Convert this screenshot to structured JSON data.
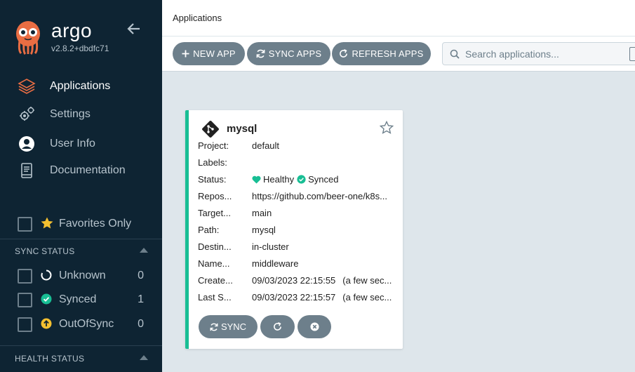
{
  "brand": {
    "name": "argo",
    "version": "v2.8.2+dbdfc71"
  },
  "nav": [
    {
      "label": "Applications",
      "icon": "stack-icon"
    },
    {
      "label": "Settings",
      "icon": "gear-icon"
    },
    {
      "label": "User Info",
      "icon": "user-icon"
    },
    {
      "label": "Documentation",
      "icon": "book-icon"
    }
  ],
  "filters": {
    "favorites_label": "Favorites Only",
    "sync_status": {
      "heading": "SYNC STATUS",
      "items": [
        {
          "label": "Unknown",
          "count": "0"
        },
        {
          "label": "Synced",
          "count": "1"
        },
        {
          "label": "OutOfSync",
          "count": "0"
        }
      ]
    },
    "health_status": {
      "heading": "HEALTH STATUS"
    }
  },
  "header": {
    "title": "Applications"
  },
  "toolbar": {
    "new_app": "NEW APP",
    "sync_apps": "SYNC APPS",
    "refresh_apps": "REFRESH APPS",
    "search_placeholder": "Search applications..."
  },
  "app": {
    "name": "mysql",
    "fields": [
      {
        "key": "Project:",
        "value": "default"
      },
      {
        "key": "Labels:",
        "value": ""
      },
      {
        "key": "Status:",
        "value": ""
      },
      {
        "key": "Repos...",
        "value": "https://github.com/beer-one/k8s..."
      },
      {
        "key": "Target...",
        "value": "main"
      },
      {
        "key": "Path:",
        "value": "mysql"
      },
      {
        "key": "Destin...",
        "value": "in-cluster"
      },
      {
        "key": "Name...",
        "value": "middleware"
      },
      {
        "key": "Create...",
        "value": "09/03/2023 22:15:55",
        "sub": "(a few sec..."
      },
      {
        "key": "Last S...",
        "value": "09/03/2023 22:15:57",
        "sub": "(a few sec..."
      }
    ],
    "health": "Healthy",
    "sync": "Synced",
    "sync_button": "SYNC"
  },
  "colors": {
    "sidebar": "#0e2433",
    "accent_green": "#18be94",
    "button_gray": "#6d7f8b",
    "warning_yellow": "#f4c030",
    "logo_orange": "#e96d43"
  }
}
